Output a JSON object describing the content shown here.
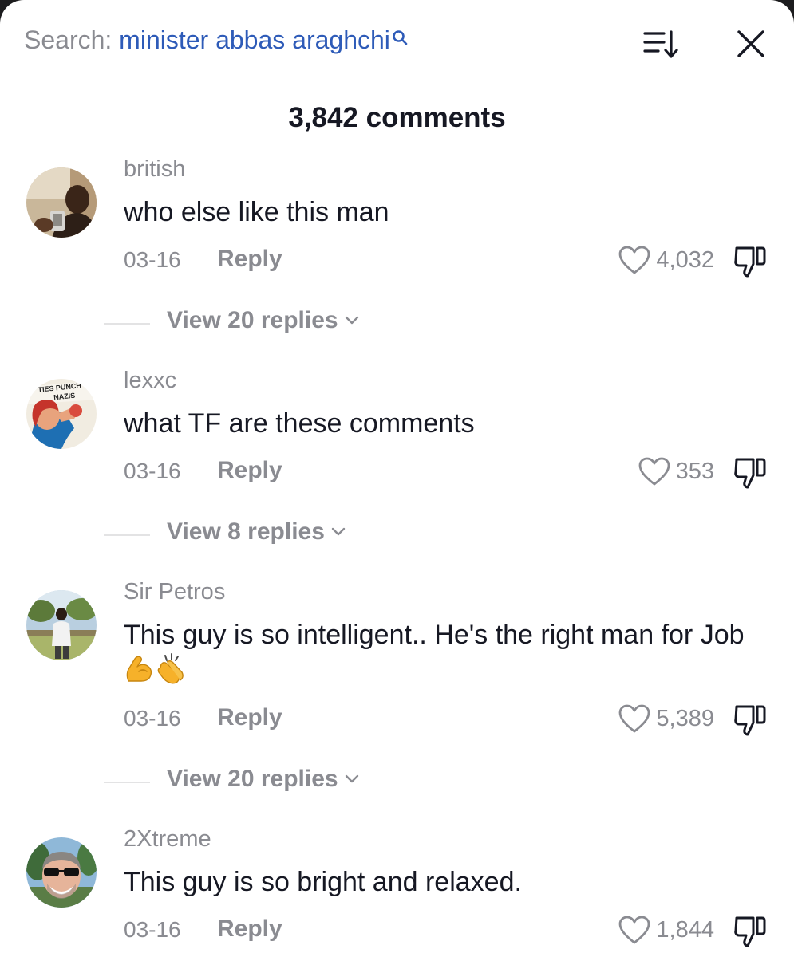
{
  "search": {
    "prefix": "Search:",
    "query": "minister abbas araghchi"
  },
  "header": {
    "comment_count": "3,842 comments"
  },
  "icons": {
    "sort": "sort-icon",
    "close": "close-icon",
    "like": "heart-icon",
    "dislike": "dislike-icon",
    "expand": "chevron-down-icon"
  },
  "colors": {
    "search_query": "#2e5bb8",
    "muted_text": "#8a8b91",
    "body_text": "#161823"
  },
  "comments": [
    {
      "username": "british",
      "text": "who else like this man",
      "date": "03-16",
      "reply_label": "Reply",
      "likes": "4,032",
      "replies_label": "View 20 replies"
    },
    {
      "username": "lexxc",
      "text": "what TF are these comments",
      "date": "03-16",
      "reply_label": "Reply",
      "likes": "353",
      "replies_label": "View 8 replies",
      "avatar_text_line1": "TIES PUNCH",
      "avatar_text_line2": "NAZIS"
    },
    {
      "username": "Sir Petros",
      "text": "This guy is so intelligent.. He's the right man for Job",
      "emojis": [
        "flexed-biceps-emoji",
        "clapping-hands-emoji"
      ],
      "date": "03-16",
      "reply_label": "Reply",
      "likes": "5,389",
      "replies_label": "View 20 replies"
    },
    {
      "username": "2Xtreme",
      "text": "This guy is so bright and relaxed.",
      "date": "03-16",
      "reply_label": "Reply",
      "likes": "1,844"
    }
  ]
}
